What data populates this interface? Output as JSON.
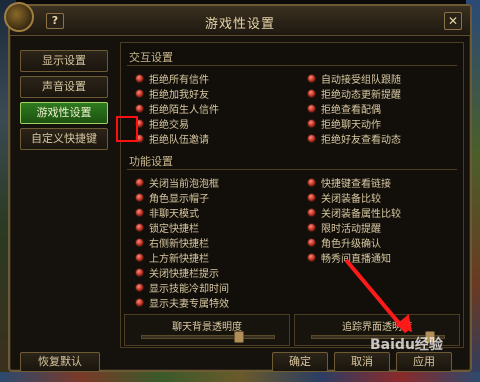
{
  "window": {
    "title": "游戏性设置",
    "help_label": "?",
    "close_label": "✕"
  },
  "top_right_text": "头",
  "sidebar": {
    "items": [
      {
        "label": "显示设置",
        "active": false
      },
      {
        "label": "声音设置",
        "active": false
      },
      {
        "label": "游戏性设置",
        "active": true
      },
      {
        "label": "自定义快捷键",
        "active": false
      }
    ]
  },
  "interaction": {
    "title": "交互设置",
    "left": [
      "拒绝所有信件",
      "拒绝加我好友",
      "拒绝陌生人信件",
      "拒绝交易",
      "拒绝队伍邀请"
    ],
    "right": [
      "自动接受组队跟随",
      "拒绝动态更新提醒",
      "拒绝查看配偶",
      "拒绝聊天动作",
      "拒绝好友查看动态"
    ]
  },
  "function": {
    "title": "功能设置",
    "left": [
      "关闭当前泡泡框",
      "角色显示帽子",
      "非聊天模式",
      "锁定快捷栏",
      "右侧新快捷栏",
      "上方新快捷栏",
      "关闭快捷栏提示",
      "显示技能冷却时间",
      "显示夫妻专属特效"
    ],
    "right": [
      "快捷键查看链接",
      "关闭装备比较",
      "关闭装备属性比较",
      "限时活动提醒",
      "角色升级确认",
      "畅秀间直播通知"
    ]
  },
  "sliders": {
    "chat_bg": {
      "label": "聊天背景透明度",
      "level": 0.75
    },
    "trace": {
      "label": "追踪界面透明度",
      "level": 0.92
    }
  },
  "buttons": {
    "restore": "恢复默认",
    "ok": "确定",
    "cancel": "取消",
    "apply": "应用"
  },
  "watermark": "Baidu经验",
  "colors": {
    "active_tab": "#2e7a1e",
    "radio": "#b8281c",
    "highlight": "#ff1010",
    "arrow": "#ff1a1a"
  }
}
